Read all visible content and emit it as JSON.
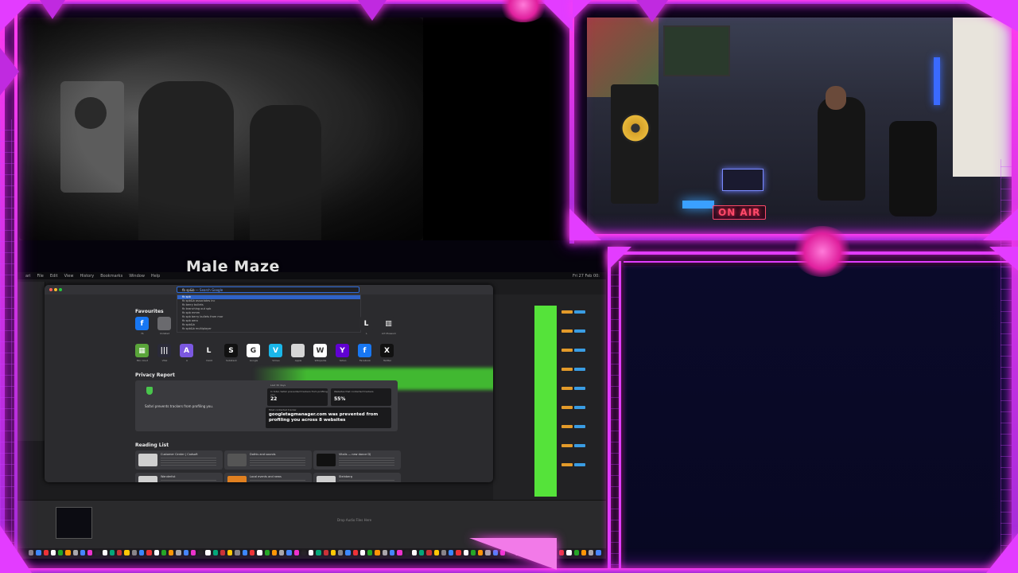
{
  "caption": "Male  Maze",
  "on_air": "ON AIR",
  "menubar": {
    "items": [
      "ari",
      "File",
      "Edit",
      "View",
      "History",
      "Bookmarks",
      "Window",
      "Help"
    ],
    "clock": "Fri 27 Feb 00:"
  },
  "browser": {
    "url_query": "fb sp&b",
    "url_hint": "— Search Google",
    "suggestions": [
      "fb spb",
      "fb spb&b associates inc",
      "fb berry bullets",
      "fb branching out spb",
      "fb spb mmm",
      "fb spb berry bullets from mar",
      "fb spb aero",
      "fb spb&b",
      "fb spb&b multiplayer"
    ],
    "favourites_title": "Favourites",
    "favourites_row1": [
      {
        "label": "fb",
        "glyph": "f",
        "color": "#1877f2"
      },
      {
        "label": "Unlisted",
        "glyph": "",
        "color": "#6a6a6e"
      },
      {
        "label": "L",
        "glyph": "L",
        "color": "#2b2b2e"
      },
      {
        "label": "Art Museum",
        "glyph": "▥",
        "color": "#2b2b2e"
      }
    ],
    "favourites_row2": [
      {
        "label": "Mix cloud",
        "glyph": "▦",
        "color": "#5aa53a"
      },
      {
        "label": "Vital",
        "glyph": "|||",
        "color": "#2a2a38"
      },
      {
        "label": "A",
        "glyph": "A",
        "color": "#7b58e0"
      },
      {
        "label": "Vizzit",
        "glyph": "L",
        "color": "#2b2b2e"
      },
      {
        "label": "Substack",
        "glyph": "S",
        "color": "#111111"
      },
      {
        "label": "Google",
        "glyph": "G",
        "color": "#ffffff"
      },
      {
        "label": "Vimeo",
        "glyph": "V",
        "color": "#1ab7ea"
      },
      {
        "label": "Apple",
        "glyph": "",
        "color": "#d6d6d6"
      },
      {
        "label": "Wikipedia",
        "glyph": "W",
        "color": "#ffffff"
      },
      {
        "label": "Yahoo",
        "glyph": "Y",
        "color": "#6001d2"
      },
      {
        "label": "Facebook",
        "glyph": "f",
        "color": "#1877f2"
      },
      {
        "label": "Twitter",
        "glyph": "X",
        "color": "#111111"
      }
    ],
    "privacy_title": "Privacy Report",
    "privacy_text": "Safari prevents trackers from profiling you.",
    "privacy_days": "Last 30 days",
    "stat1_label": "In total, Safari prevented trackers from profiling you",
    "stat1_value": "22",
    "stat2_label": "Websites that contacted trackers",
    "stat2_value": "55%",
    "tracker_label": "Most contacted tracker",
    "tracker_text": "googletagmanager.com was prevented from profiling you across 8 websites",
    "reading_title": "Reading List",
    "reading": [
      {
        "title": "Customer Center | Cadsoft",
        "thumb": "#cfcfcf"
      },
      {
        "title": "Dothis and sounds",
        "thumb": "#555555"
      },
      {
        "title": "Vitalis — new dance DJ",
        "thumb": "#111111"
      },
      {
        "title": "Wanderlist",
        "thumb": "#d0d0d0"
      },
      {
        "title": "Local events and news",
        "thumb": "#e08020"
      },
      {
        "title": "Steinberg",
        "thumb": "#cfcfcf"
      }
    ]
  },
  "daw": {
    "tracks_hint": "Drop Audio Files Here"
  }
}
